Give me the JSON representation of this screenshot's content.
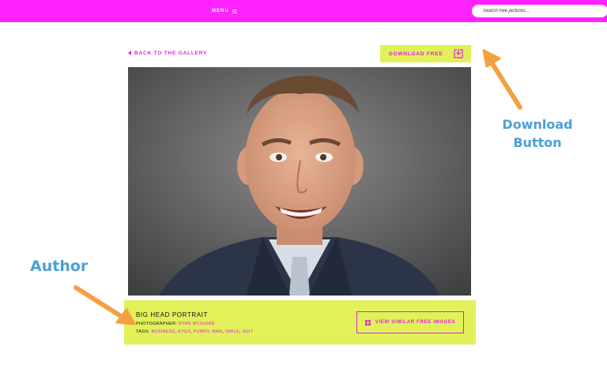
{
  "header": {
    "menu_label": "MENU",
    "search_placeholder": "Search free pictures...",
    "brand_color": "#ff22ff"
  },
  "nav": {
    "back_label": "BACK TO THE GALLERY"
  },
  "download": {
    "label": "DOWNLOAD FREE",
    "icon": "download-icon"
  },
  "photo": {
    "subject": "portrait"
  },
  "info": {
    "title": "BIG HEAD PORTRAIT",
    "photographer_label": "PHOTOGRAPHER:",
    "photographer_name": "RYAN MCGUIRE",
    "tags_label": "TAGS:",
    "tags": [
      "BUSINESS",
      "EYES",
      "FUNNY",
      "MAN",
      "SMILE",
      "SUIT"
    ],
    "similar_label": "VIEW SIMILAR FREE IMAGES",
    "box_color": "#e2f05a",
    "accent_color": "#e020e0"
  },
  "annotations": {
    "download_line1": "Download",
    "download_line2": "Button",
    "author": "Author",
    "color": "#4aa0d8",
    "arrow_color": "#f5a040"
  }
}
